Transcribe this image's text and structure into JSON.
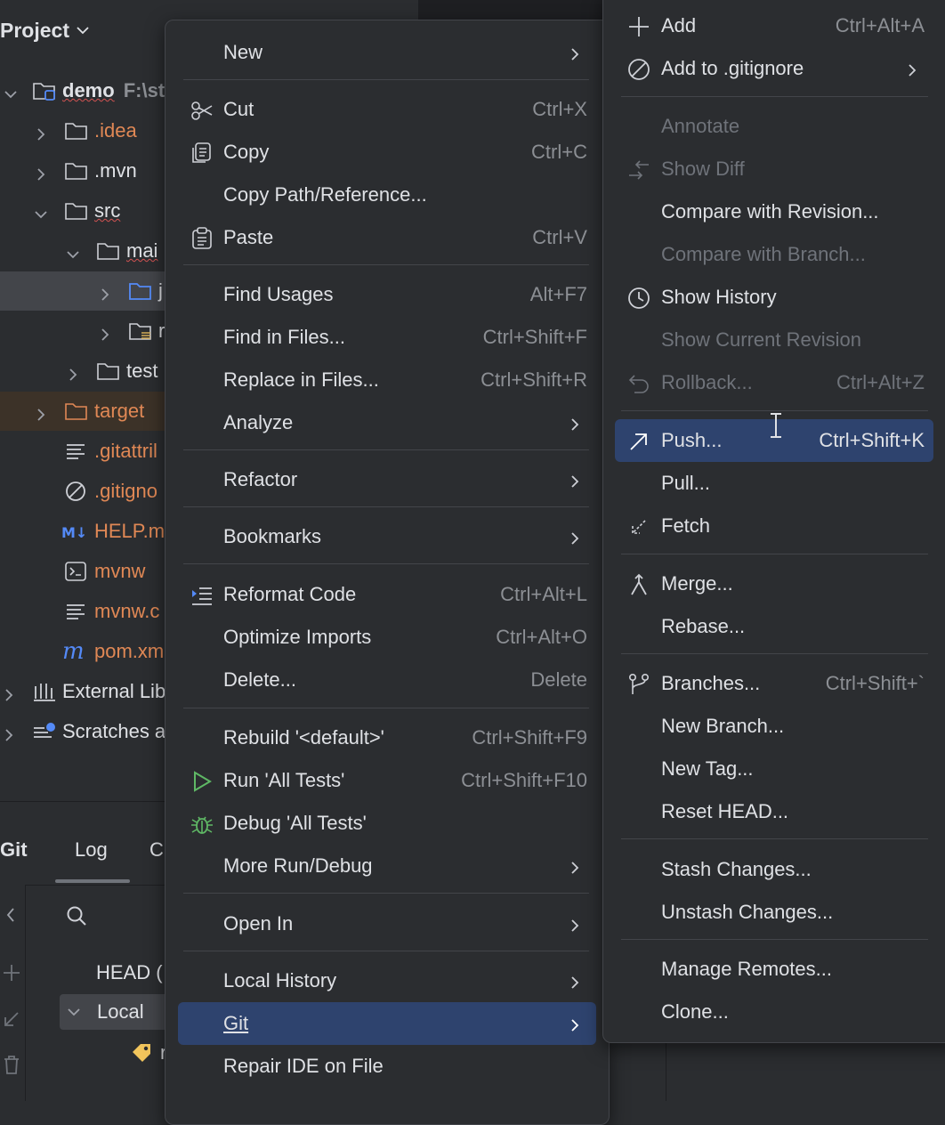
{
  "project": {
    "title": "Project",
    "tree": [
      {
        "label": "demo",
        "hint": "F:\\st",
        "bold": true,
        "icon": "module-folder-icon"
      },
      {
        "label": ".idea",
        "orange": true,
        "icon": "folder-icon"
      },
      {
        "label": ".mvn",
        "icon": "folder-icon"
      },
      {
        "label": "src",
        "icon": "folder-icon"
      },
      {
        "label": "mai",
        "icon": "folder-icon"
      },
      {
        "label": "j",
        "icon": "source-folder-icon"
      },
      {
        "label": "r",
        "icon": "resources-folder-icon"
      },
      {
        "label": "test",
        "icon": "folder-icon"
      },
      {
        "label": "target",
        "orange": true,
        "icon": "folder-icon"
      },
      {
        "label": ".gitattril",
        "orange": true,
        "icon": "text-file-icon"
      },
      {
        "label": ".gitigno",
        "orange": true,
        "icon": "ignore-file-icon"
      },
      {
        "label": "HELP.m",
        "orange": true,
        "icon": "markdown-icon"
      },
      {
        "label": "mvnw",
        "orange": true,
        "icon": "shell-script-icon"
      },
      {
        "label": "mvnw.c",
        "orange": true,
        "icon": "text-file-icon"
      },
      {
        "label": "pom.xm",
        "orange": true,
        "icon": "maven-icon"
      },
      {
        "label": "External Lib",
        "icon": "library-icon"
      },
      {
        "label": "Scratches a",
        "icon": "scratches-icon"
      }
    ]
  },
  "git_panel": {
    "tabs": [
      "Git",
      "Log",
      "C"
    ],
    "head_label": "HEAD (",
    "local_label": "Local",
    "tag_label": "r"
  },
  "main_menu": {
    "items": [
      {
        "label": "New",
        "submenu": true
      },
      {
        "label": "Cut",
        "shortcut": "Ctrl+X",
        "icon": "scissors-icon"
      },
      {
        "label": "Copy",
        "shortcut": "Ctrl+C",
        "icon": "copy-icon"
      },
      {
        "label": "Copy Path/Reference..."
      },
      {
        "label": "Paste",
        "shortcut": "Ctrl+V",
        "icon": "clipboard-icon"
      },
      {
        "label": "Find Usages",
        "shortcut": "Alt+F7"
      },
      {
        "label": "Find in Files...",
        "shortcut": "Ctrl+Shift+F"
      },
      {
        "label": "Replace in Files...",
        "shortcut": "Ctrl+Shift+R"
      },
      {
        "label": "Analyze",
        "submenu": true
      },
      {
        "label": "Refactor",
        "submenu": true
      },
      {
        "label": "Bookmarks",
        "submenu": true
      },
      {
        "label": "Reformat Code",
        "shortcut": "Ctrl+Alt+L",
        "icon": "reformat-icon"
      },
      {
        "label": "Optimize Imports",
        "shortcut": "Ctrl+Alt+O"
      },
      {
        "label": "Delete...",
        "shortcut": "Delete"
      },
      {
        "label": "Rebuild '<default>'",
        "shortcut": "Ctrl+Shift+F9"
      },
      {
        "label": "Run 'All Tests'",
        "shortcut": "Ctrl+Shift+F10",
        "icon": "run-icon"
      },
      {
        "label": "Debug 'All Tests'",
        "icon": "debug-icon"
      },
      {
        "label": "More Run/Debug",
        "submenu": true
      },
      {
        "label": "Open In",
        "submenu": true
      },
      {
        "label": "Local History",
        "submenu": true
      },
      {
        "label": "Git",
        "submenu": true,
        "highlighted": true
      },
      {
        "label": "Repair IDE on File"
      }
    ]
  },
  "git_menu": {
    "items": [
      {
        "label": "Add",
        "shortcut": "Ctrl+Alt+A",
        "icon": "plus-icon"
      },
      {
        "label": "Add to .gitignore",
        "submenu": true,
        "icon": "ignore-icon"
      },
      {
        "label": "Annotate",
        "disabled": true
      },
      {
        "label": "Show Diff",
        "disabled": true,
        "icon": "diff-icon"
      },
      {
        "label": "Compare with Revision..."
      },
      {
        "label": "Compare with Branch...",
        "disabled": true
      },
      {
        "label": "Show History",
        "icon": "history-icon"
      },
      {
        "label": "Show Current Revision",
        "disabled": true
      },
      {
        "label": "Rollback...",
        "shortcut": "Ctrl+Alt+Z",
        "disabled": true,
        "icon": "rollback-icon"
      },
      {
        "label": "Push...",
        "shortcut": "Ctrl+Shift+K",
        "highlighted": true,
        "icon": "push-icon"
      },
      {
        "label": "Pull..."
      },
      {
        "label": "Fetch",
        "icon": "fetch-icon"
      },
      {
        "label": "Merge...",
        "icon": "merge-icon"
      },
      {
        "label": "Rebase..."
      },
      {
        "label": "Branches...",
        "shortcut": "Ctrl+Shift+`",
        "icon": "branch-icon"
      },
      {
        "label": "New Branch..."
      },
      {
        "label": "New Tag..."
      },
      {
        "label": "Reset HEAD..."
      },
      {
        "label": "Stash Changes..."
      },
      {
        "label": "Unstash Changes..."
      },
      {
        "label": "Manage Remotes..."
      },
      {
        "label": "Clone..."
      }
    ]
  },
  "colors": {
    "background": "#2b2d30",
    "selection": "#2e436e",
    "text": "#dfe1e5",
    "muted": "#8c8f94",
    "disabled": "#6f737a",
    "ignored_file": "#e08855",
    "accent_blue": "#548af7"
  }
}
